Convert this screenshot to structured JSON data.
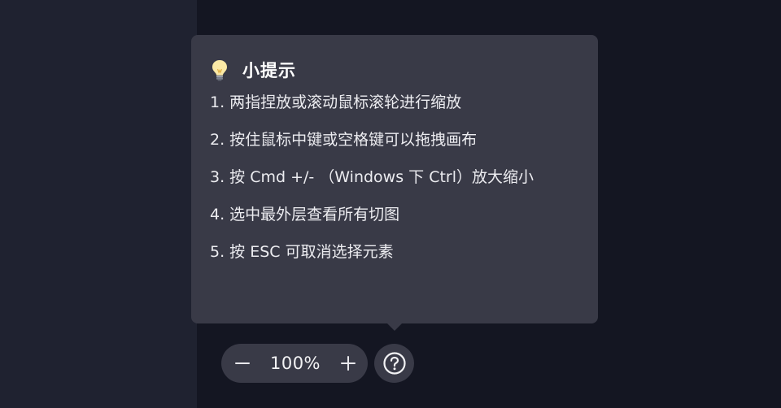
{
  "tips": {
    "icon": "lightbulb-icon",
    "title": "小提示",
    "items": [
      "1. 两指捏放或滚动鼠标滚轮进行缩放",
      "2. 按住鼠标中键或空格键可以拖拽画布",
      "3. 按 Cmd +/- （Windows 下 Ctrl）放大缩小",
      "4. 选中最外层查看所有切图",
      "5. 按 ESC 可取消选择元素"
    ]
  },
  "zoom": {
    "level": "100%",
    "decrease_icon": "minus-icon",
    "increase_icon": "plus-icon"
  },
  "help": {
    "icon": "question-circle-icon"
  },
  "colors": {
    "background": "#141622",
    "side_panel": "#1f2230",
    "popover": "#393a47",
    "text": "#ececf0"
  }
}
